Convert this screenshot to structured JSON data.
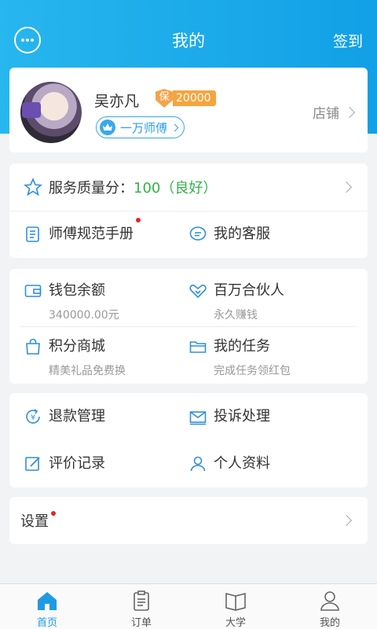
{
  "header": {
    "title": "我的",
    "signin_label": "签到"
  },
  "profile": {
    "name": "吴亦凡",
    "guarantee_badge": "保",
    "guarantee_amount": "20000",
    "level_label": "一万师傅",
    "shop_label": "店铺"
  },
  "quality": {
    "label": "服务质量分：",
    "score": "100（良好）"
  },
  "links": {
    "manual": "师傅规范手册",
    "service": "我的客服"
  },
  "wallet": {
    "balance_label": "钱包余额",
    "balance_value": "340000.00元",
    "partner_label": "百万合伙人",
    "partner_sub": "永久赚钱",
    "mall_label": "积分商城",
    "mall_sub": "精美礼品免费换",
    "tasks_label": "我的任务",
    "tasks_sub": "完成任务领红包"
  },
  "management": {
    "refund": "退款管理",
    "complaint": "投诉处理",
    "review": "评价记录",
    "profile": "个人资料"
  },
  "settings": {
    "label": "设置"
  },
  "tabs": [
    {
      "label": "首页",
      "icon": "home-icon"
    },
    {
      "label": "订单",
      "icon": "order-icon"
    },
    {
      "label": "大学",
      "icon": "book-icon"
    },
    {
      "label": "我的",
      "icon": "user-icon"
    }
  ],
  "colors": {
    "accent": "#1e9be3",
    "header_gradient_start": "#27b6ee",
    "header_gradient_end": "#12a0e6",
    "good": "#35b14a",
    "badge": "#f5a53e"
  }
}
